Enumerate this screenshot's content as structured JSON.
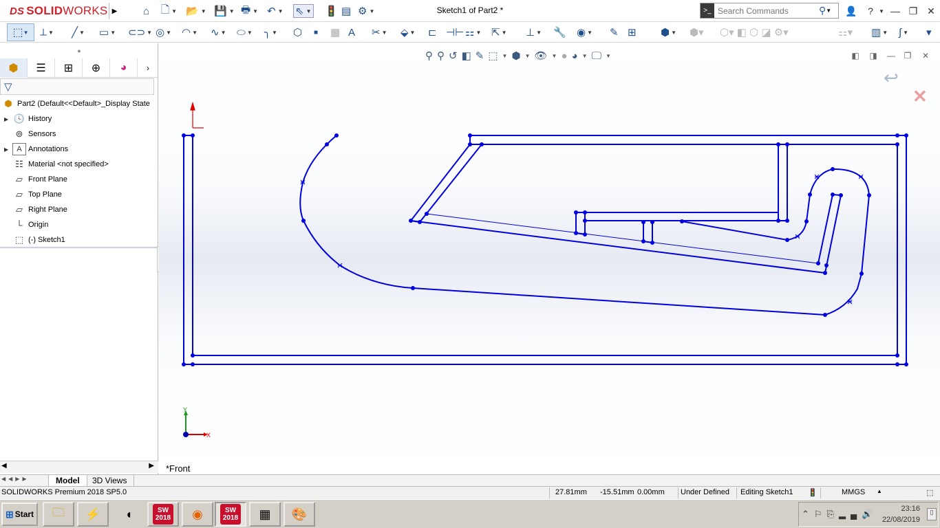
{
  "app": {
    "brand_ds": "DS",
    "brand_solid": "SOLID",
    "brand_works": "WORKS",
    "title": "Sketch1 of Part2 *"
  },
  "search": {
    "placeholder": "Search Commands"
  },
  "colors": {
    "sketch_line": "#0000dd",
    "origin_red": "#e00000",
    "accent": "#1f4e8c"
  },
  "feature_tree": {
    "part_label": "Part2  (Default<<Default>_Display State",
    "items": [
      {
        "label": "History",
        "icon": "history-folder-icon",
        "expandable": true
      },
      {
        "label": "Sensors",
        "icon": "sensor-icon",
        "expandable": false
      },
      {
        "label": "Annotations",
        "icon": "annotations-icon",
        "expandable": true
      },
      {
        "label": "Material <not specified>",
        "icon": "material-icon",
        "expandable": false
      },
      {
        "label": "Front Plane",
        "icon": "plane-icon",
        "expandable": false
      },
      {
        "label": "Top Plane",
        "icon": "plane-icon",
        "expandable": false
      },
      {
        "label": "Right Plane",
        "icon": "plane-icon",
        "expandable": false
      },
      {
        "label": "Origin",
        "icon": "origin-icon",
        "expandable": false
      },
      {
        "label": "(-) Sketch1",
        "icon": "sketch-icon",
        "expandable": false
      }
    ]
  },
  "viewport": {
    "view_label": "*Front",
    "axis_x": "X",
    "axis_y": "Y"
  },
  "bottom_tabs": {
    "model": "Model",
    "views_3d": "3D Views"
  },
  "status": {
    "product": "SOLIDWORKS Premium 2018 SP5.0",
    "x": "27.81mm",
    "y": "-15.51mm",
    "z": "0.00mm",
    "definition": "Under Defined",
    "editing": "Editing Sketch1",
    "units": "MMGS"
  },
  "taskbar": {
    "start": "Start",
    "sw_label_top": "SW",
    "sw_label_year": "2018",
    "time": "23:16",
    "date": "22/08/2019"
  }
}
